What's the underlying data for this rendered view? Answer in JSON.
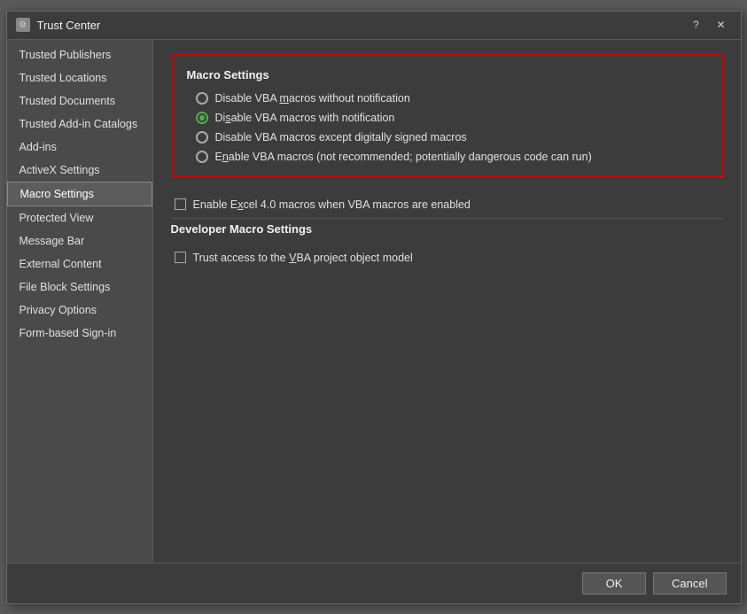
{
  "dialog": {
    "title": "Trust Center",
    "help_btn": "?",
    "close_btn": "✕"
  },
  "sidebar": {
    "items": [
      {
        "id": "trusted-publishers",
        "label": "Trusted Publishers",
        "active": false
      },
      {
        "id": "trusted-locations",
        "label": "Trusted Locations",
        "active": false
      },
      {
        "id": "trusted-documents",
        "label": "Trusted Documents",
        "active": false
      },
      {
        "id": "trusted-add-in-catalogs",
        "label": "Trusted Add-in Catalogs",
        "active": false
      },
      {
        "id": "add-ins",
        "label": "Add-ins",
        "active": false
      },
      {
        "id": "activex-settings",
        "label": "ActiveX Settings",
        "active": false
      },
      {
        "id": "macro-settings",
        "label": "Macro Settings",
        "active": true
      },
      {
        "id": "protected-view",
        "label": "Protected View",
        "active": false
      },
      {
        "id": "message-bar",
        "label": "Message Bar",
        "active": false
      },
      {
        "id": "external-content",
        "label": "External Content",
        "active": false
      },
      {
        "id": "file-block-settings",
        "label": "File Block Settings",
        "active": false
      },
      {
        "id": "privacy-options",
        "label": "Privacy Options",
        "active": false
      },
      {
        "id": "form-based-sign-in",
        "label": "Form-based Sign-in",
        "active": false
      }
    ]
  },
  "content": {
    "macro_settings_title": "Macro Settings",
    "radio_options": [
      {
        "id": "disable-no-notify",
        "label": "Disable VBA macros without notification",
        "selected": false,
        "underline_char": "m"
      },
      {
        "id": "disable-notify",
        "label": "Disable VBA macros with notification",
        "selected": true,
        "underline_char": "s"
      },
      {
        "id": "disable-signed",
        "label": "Disable VBA macros except digitally signed macros",
        "selected": false,
        "underline_char": ""
      },
      {
        "id": "enable-all",
        "label": "Enable VBA macros (not recommended; potentially dangerous code can run)",
        "selected": false,
        "underline_char": "n"
      }
    ],
    "excel_checkbox_label": "Enable Excel 4.0 macros when VBA macros are enabled",
    "excel_checkbox_checked": false,
    "developer_section_title": "Developer Macro Settings",
    "vba_checkbox_label": "Trust access to the VBA project object model",
    "vba_checkbox_checked": false
  },
  "footer": {
    "ok_label": "OK",
    "cancel_label": "Cancel"
  }
}
